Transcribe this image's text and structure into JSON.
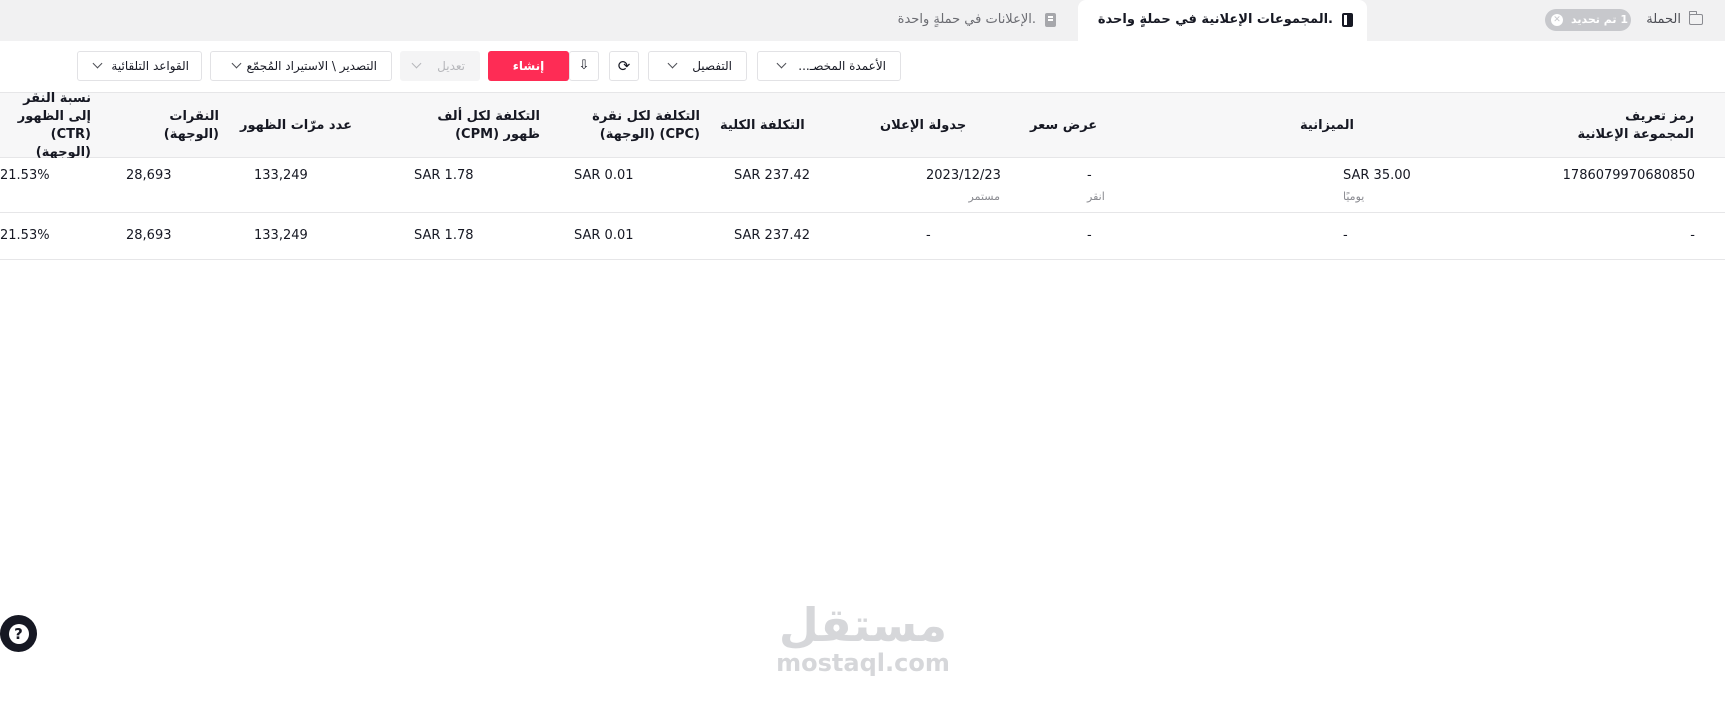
{
  "breadcrumb": {
    "campaign_label": "الحملة",
    "update_badge": "1 تم تحديد"
  },
  "tabs": [
    {
      "label": "المجموعات الإعلانية في حملةٍ واحدة."
    },
    {
      "label": "الإعلانات في حملةٍ واحدة."
    }
  ],
  "toolbar": {
    "columns_label": "الأعمدة المخصـ...",
    "breakdown_label": "التفصيل",
    "refresh_icon": "⟳",
    "download_icon": "⇩",
    "create_label": "إنشاء",
    "edit_label": "تعديل",
    "export_label": "التصدير \\ الاستيراد المُجمّع",
    "rules_label": "القواعد التلقائية"
  },
  "table": {
    "headers": {
      "adgroup_id": "رمز تعريف المجموعة الإعلانية",
      "budget": "الميزانية",
      "bid": "عرض سعر",
      "schedule": "جدولة الإعلان",
      "total_cost": "التكلفة الكلية",
      "cpc": "التكلفة لكل نقرة (CPC) (الوجهة)",
      "cpm": "التكلفة لكل ألف ظهور (CPM)",
      "impressions": "عدد مرّات الظهور",
      "clicks": "النقرات (الوجهة)",
      "ctr": "نسبة النقر إلى الظهور (CTR) (الوجهة)"
    },
    "rows": [
      {
        "adgroup_id": "1786079970680850",
        "budget": "SAR 35.00",
        "budget_sub": "يوميًا",
        "bid": "-",
        "bid_sub": "انقر",
        "schedule": "2023/12/23",
        "schedule_sub": "مستمر",
        "total_cost": "SAR 237.42",
        "cpc": "SAR 0.01",
        "cpm": "SAR 1.78",
        "impressions": "133,249",
        "clicks": "28,693",
        "ctr": "21.53%"
      },
      {
        "adgroup_id": "-",
        "budget": "-",
        "bid": "-",
        "schedule": "-",
        "total_cost": "SAR 237.42",
        "cpc": "SAR 0.01",
        "cpm": "SAR 1.78",
        "impressions": "133,249",
        "clicks": "28,693",
        "ctr": "21.53%"
      }
    ]
  },
  "help": {
    "icon": "?"
  },
  "watermark": {
    "arabic": "مستقل",
    "latin": "mostaql.com"
  }
}
